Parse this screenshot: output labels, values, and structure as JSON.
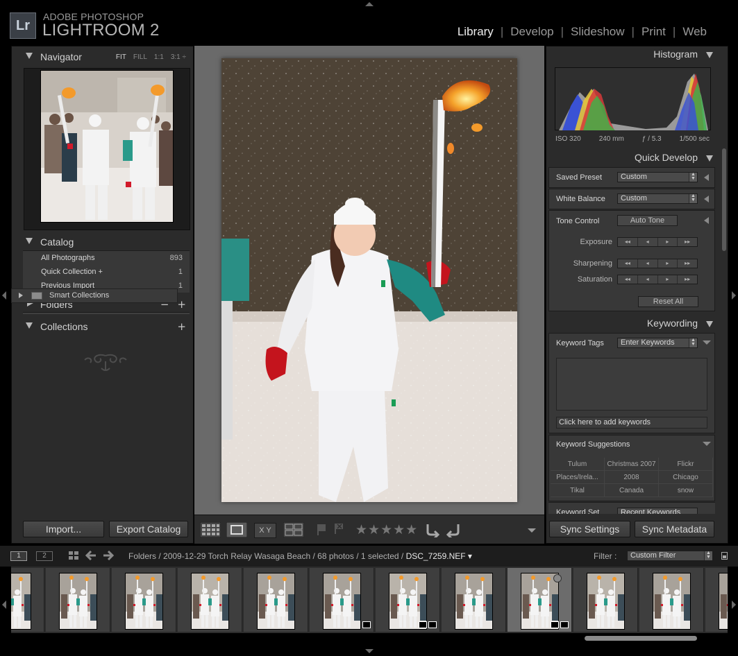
{
  "app": {
    "logo": "Lr",
    "brand_top": "ADOBE PHOTOSHOP",
    "brand_main": "LIGHTROOM 2",
    "modules": [
      "Library",
      "Develop",
      "Slideshow",
      "Print",
      "Web"
    ],
    "active_module": "Library"
  },
  "navigator": {
    "title": "Navigator",
    "zoom": [
      "FIT",
      "FILL",
      "1:1",
      "3:1 ÷"
    ]
  },
  "catalog": {
    "title": "Catalog",
    "items": [
      {
        "label": "All Photographs",
        "count": "893"
      },
      {
        "label": "Quick Collection  +",
        "count": "1"
      },
      {
        "label": "Previous Import",
        "count": "1"
      }
    ]
  },
  "folders": {
    "title": "Folders",
    "minus": "−",
    "plus": "+"
  },
  "collections": {
    "title": "Collections",
    "plus": "+",
    "smart": "Smart Collections"
  },
  "left_buttons": {
    "import": "Import...",
    "export": "Export Catalog"
  },
  "histogram": {
    "title": "Histogram",
    "iso": "ISO 320",
    "focal": "240 mm",
    "aperture": "ƒ / 5.3",
    "shutter": "1/500 sec"
  },
  "quick_develop": {
    "title": "Quick Develop",
    "saved_preset_label": "Saved Preset",
    "saved_preset_value": "Custom",
    "white_balance_label": "White Balance",
    "white_balance_value": "Custom",
    "tone_label": "Tone Control",
    "auto_tone": "Auto Tone",
    "exposure": "Exposure",
    "sharpening": "Sharpening",
    "saturation": "Saturation",
    "step_glyphs": [
      "◂◂",
      "◂",
      "▸",
      "▸▸"
    ],
    "reset_all": "Reset All"
  },
  "keywording": {
    "title": "Keywording",
    "tags_label": "Keyword Tags",
    "tags_value": "Enter Keywords",
    "add_placeholder": "Click here to add keywords",
    "suggestions_title": "Keyword Suggestions",
    "suggestions": [
      "Tulum",
      "Christmas 2007",
      "Flickr",
      "Places/Irela...",
      "2008",
      "Chicago",
      "Tikal",
      "Canada",
      "snow"
    ],
    "set_label": "Keyword Set",
    "set_value": "Recent Keywords"
  },
  "right_buttons": {
    "sync_settings": "Sync Settings",
    "sync_metadata": "Sync Metadata"
  },
  "toolbar": {
    "grid_icon": "grid-view-icon",
    "loupe_icon": "loupe-view-icon",
    "compare_label": "X Y",
    "stars": "★★★★★"
  },
  "filmstrip": {
    "page1": "1",
    "page2": "2",
    "breadcrumb": "Folders / 2009-12-29 Torch Relay Wasaga Beach / 68 photos / 1 selected / ",
    "filename": "DSC_7259.NEF ▾",
    "filter_label": "Filter :",
    "filter_value": "Custom Filter",
    "selected_index": 8
  },
  "colors": {
    "panel": "#2b2b2b",
    "center_bg": "#6a6a6a",
    "active_module": "#efefef"
  }
}
